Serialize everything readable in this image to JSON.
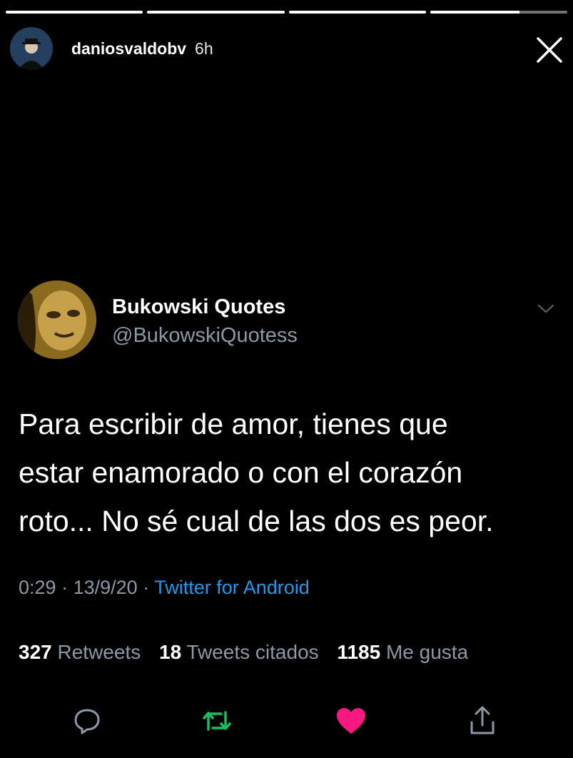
{
  "story": {
    "progress": [
      1,
      1,
      1,
      0.65
    ],
    "username": "daniosvaldobv",
    "time": "6h"
  },
  "tweet": {
    "display_name": "Bukowski Quotes",
    "handle": "@BukowskiQuotess",
    "text": "Para escribir de amor, tienes que\nestar enamorado o con el corazón\nroto... No sé cual de las dos es peor.",
    "time": "0:29",
    "date": "13/9/20",
    "separator": "·",
    "source": "Twitter for Android",
    "stats": {
      "retweets": "327",
      "retweets_label": "Retweets",
      "quotes": "18",
      "quotes_label": "Tweets citados",
      "likes": "1185",
      "likes_label": "Me gusta"
    }
  },
  "icons": {
    "close": "close-icon",
    "chevron": "chevron-down-icon",
    "reply": "reply-icon",
    "retweet": "retweet-icon",
    "like": "heart-icon",
    "share": "share-icon"
  },
  "colors": {
    "background": "#000000",
    "secondary_text": "#8b98a5",
    "link": "#1d9bf0",
    "retweet": "#17bf63",
    "like": "#f91880"
  }
}
